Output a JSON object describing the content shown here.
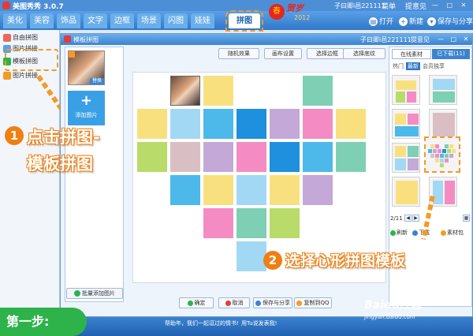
{
  "app": {
    "title": "美图秀秀 3.0.7",
    "user": "子曰卿i邑221111",
    "menu": "菜单",
    "feedback": "提意见",
    "window_buttons": "— □ ✕"
  },
  "tabs": [
    "美化",
    "美容",
    "饰品",
    "文字",
    "边框",
    "场景",
    "闪图",
    "娃娃",
    "拼图"
  ],
  "festival": {
    "badge": "春",
    "text": "贺岁",
    "year": "2012"
  },
  "toolbar": {
    "open": "打开",
    "new": "新建",
    "save": "保存与分享"
  },
  "left_modes": [
    {
      "label": "自由拼图",
      "color": "#e86a5b"
    },
    {
      "label": "图片拼接",
      "color": "#5aa0e8"
    },
    {
      "label": "模板拼图",
      "color": "#2db34a"
    },
    {
      "label": "图片拼接",
      "color": "#f59a23"
    }
  ],
  "dialog": {
    "title": "模板拼图",
    "user": "子曰卿i邑221111",
    "feedback": "提意见",
    "window_buttons": "— □ ✕"
  },
  "thumbs": {
    "replace": "替换",
    "add": "添加图片",
    "batch_add": "批量添加图片"
  },
  "canvas_buttons": [
    "随机效果",
    "画布设置",
    "选择边框",
    "选择底纹"
  ],
  "canvas_cells": [
    {
      "c": "photo"
    },
    {
      "c": "#f9e07f"
    },
    {
      "c": "#ffffff"
    },
    {
      "c": "#7ecfb3"
    },
    {
      "c": "#f9e07f"
    },
    {
      "c": "#a3d8f4"
    },
    {
      "c": "#4db8ea"
    },
    {
      "c": "#1e90dd"
    },
    {
      "c": "#c3a8d8"
    },
    {
      "c": "#f48cc3"
    },
    {
      "c": "#f9e07f"
    },
    {
      "c": "#b8db6a"
    },
    {
      "c": "#d9bfc3"
    },
    {
      "c": "#c3a8d8"
    },
    {
      "c": "#f48cc3"
    },
    {
      "c": "#1e90dd"
    },
    {
      "c": "#4db8ea"
    },
    {
      "c": "#7ecfb3"
    },
    {
      "c": "#4db8ea"
    },
    {
      "c": "#f9e07f"
    },
    {
      "c": "#a3d8f4"
    },
    {
      "c": "#f9e07f"
    },
    {
      "c": "#c3a8d8"
    },
    {
      "c": "#f48cc3"
    },
    {
      "c": "#7ecfb3"
    },
    {
      "c": "#b8db6a"
    },
    {
      "c": "#a3d8f4"
    },
    {
      "c": "#f48cc3"
    }
  ],
  "bottom_buttons": [
    {
      "label": "确定",
      "color": "#2db34a"
    },
    {
      "label": "取消",
      "color": "#e23b3b"
    },
    {
      "label": "保存与分享",
      "color": "#3b83d0"
    },
    {
      "label": "复制到QQ",
      "color": "#f59a23"
    }
  ],
  "right_panel": {
    "tabs": [
      "在线素材",
      "已下载(11)"
    ],
    "subtabs": [
      "热门",
      "最新",
      "会员独享"
    ],
    "page": "2/11",
    "refresh": "刷新",
    "download": "下载",
    "library": "素材包"
  },
  "footer": {
    "text1": "帮助年，我们一起逗过的情书!",
    "text2": "用Tu说发表我!"
  },
  "annotations": {
    "step": "第一步:",
    "one_num": "1",
    "one_text": "点击拼图-",
    "one_text2": "模板拼图",
    "two_num": "2",
    "two_text": "选择心形拼图模板",
    "watermark": "Baidu经验",
    "watermark2": "jingyan.baidu.com"
  },
  "colors": {
    "accent": "#f07f12",
    "nav": "#2f78c9",
    "green": "#2db34a"
  }
}
